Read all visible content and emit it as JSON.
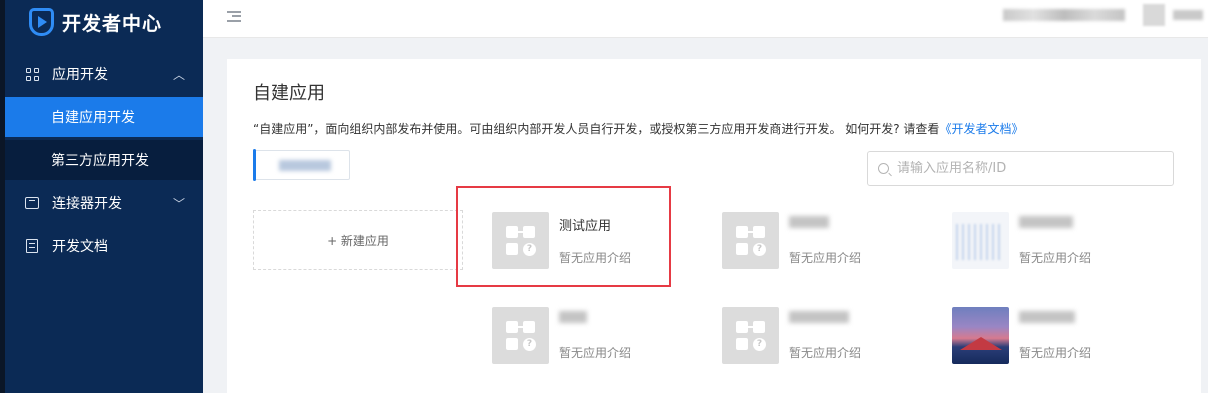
{
  "sidebar": {
    "logo_text": "开发者中心",
    "menu": [
      {
        "label": "应用开发",
        "icon": "grid-icon",
        "expanded": true,
        "children": [
          {
            "label": "自建应用开发",
            "active": true
          },
          {
            "label": "第三方应用开发",
            "active": false
          }
        ]
      },
      {
        "label": "连接器开发",
        "icon": "box-icon",
        "expanded": false
      },
      {
        "label": "开发文档",
        "icon": "doc-icon"
      }
    ]
  },
  "header": {
    "collapse_icon": "menu-fold-icon"
  },
  "main": {
    "title": "自建应用",
    "description": "“自建应用”，面向组织内部发布并使用。可由组织内部开发人员自行开发，或授权第三方应用开发商进行开发。 如何开发? 请查看",
    "doc_link": "《开发者文档》",
    "search_placeholder": "请输入应用名称/ID",
    "new_app_label": "+ 新建应用",
    "apps": [
      {
        "name": "测试应用",
        "intro": "暂无应用介绍",
        "thumb": "placeholder",
        "highlighted": true
      },
      {
        "name": "",
        "intro": "暂无应用介绍",
        "thumb": "placeholder"
      },
      {
        "name": "",
        "intro": "暂无应用介绍",
        "thumb": "chart-screenshot"
      },
      {
        "name": "",
        "intro": "暂无应用介绍",
        "thumb": "placeholder"
      },
      {
        "name": "",
        "intro": "暂无应用介绍",
        "thumb": "placeholder"
      },
      {
        "name": "",
        "intro": "暂无应用介绍",
        "thumb": "mountain-photo"
      }
    ]
  },
  "colors": {
    "sidebar_bg": "#0b2a55",
    "active": "#1b7bea",
    "highlight_border": "#e63a44"
  }
}
